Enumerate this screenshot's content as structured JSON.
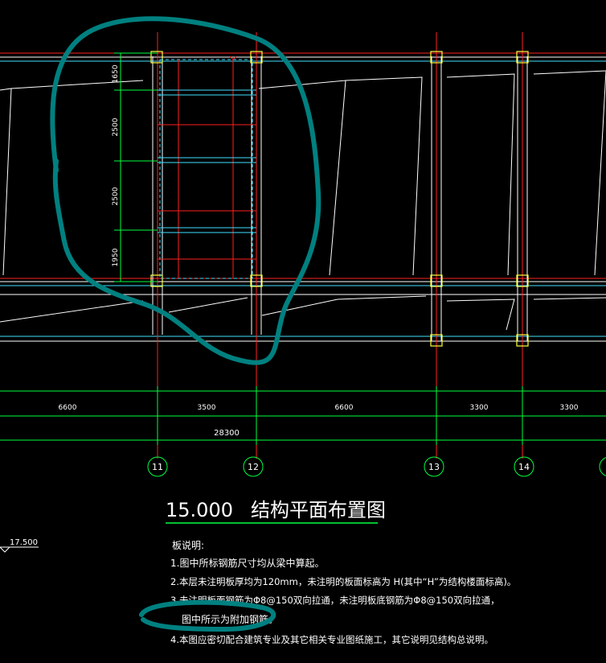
{
  "drawing": {
    "title_elevation": "15.000",
    "title_name": "结构平面布置图",
    "side_elevation": "17.500",
    "notes_header": "板说明:",
    "notes": [
      "1.图中所标钢筋尺寸均从梁中算起。",
      "2.本层未注明板厚均为120mm，未注明的板面标高为 H(其中“H”为结构楼面标高)。",
      "3.未注明板面钢筋为Φ8@150双向拉通，未注明板底钢筋为Φ8@150双向拉通，",
      "图中所示为附加钢筋。",
      "4.本图应密切配合建筑专业及其它相关专业图纸施工，其它说明见结构总说明。"
    ],
    "axis_labels": [
      "11",
      "12",
      "13",
      "14"
    ],
    "bay_dimensions": [
      "6600",
      "3500",
      "6600",
      "3300",
      "3300"
    ],
    "total_dimension": "28300",
    "vertical_dimensions": [
      "1650",
      "2500",
      "2500",
      "1950"
    ]
  },
  "colors": {
    "background": "#000000",
    "grid_axis": "#ff2020",
    "beam": "#ffffff",
    "column": "#ffff40",
    "dimension": "#00ff40",
    "secondary": "#40e0ff",
    "annotation_marker": "#008080"
  }
}
